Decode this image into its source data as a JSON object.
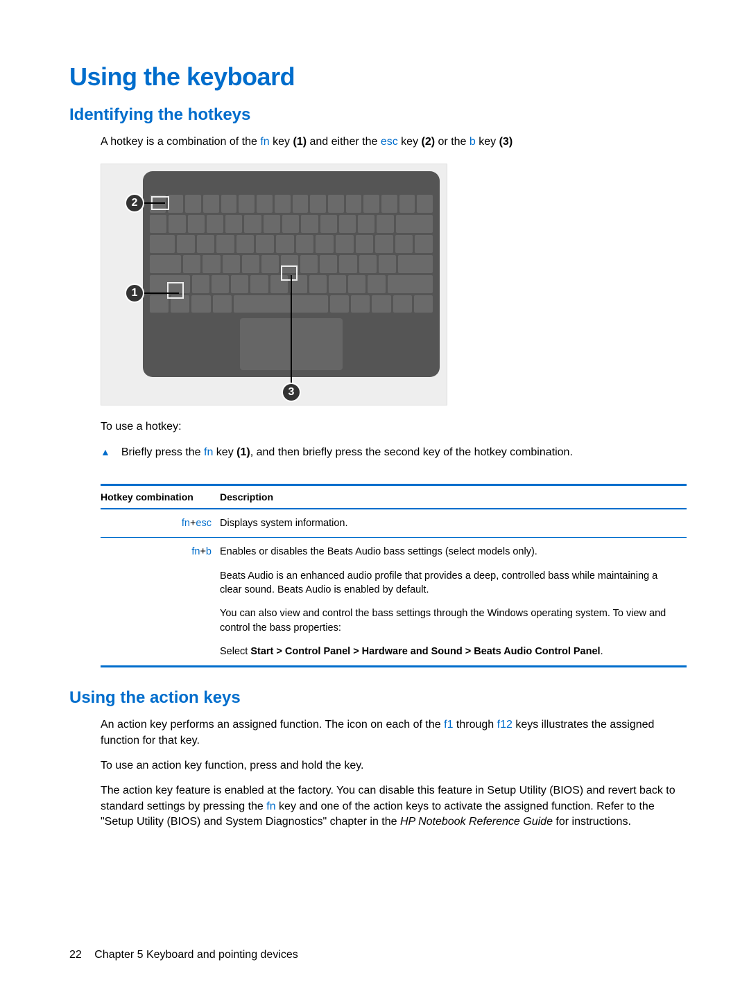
{
  "headings": {
    "main": "Using the keyboard",
    "sub1": "Identifying the hotkeys",
    "sub2": "Using the action keys"
  },
  "intro_parts": {
    "p1a": "A hotkey is a combination of the ",
    "fn": "fn",
    "p1b": " key ",
    "b1": "(1)",
    "p1c": " and either the ",
    "esc": "esc",
    "p1d": " key ",
    "b2": "(2)",
    "p1e": " or the ",
    "bkey": "b",
    "p1f": " key ",
    "b3": "(3)"
  },
  "callouts": {
    "one": "1",
    "two": "2",
    "three": "3"
  },
  "use_hotkey_label": "To use a hotkey:",
  "step_marker": "▲",
  "step_parts": {
    "a": "Briefly press the ",
    "fn": "fn",
    "b": " key ",
    "one": "(1)",
    "c": ", and then briefly press the second key of the hotkey combination."
  },
  "table": {
    "headers": {
      "combo": "Hotkey combination",
      "desc": "Description"
    },
    "row1": {
      "combo_a": "fn",
      "combo_plus": "+",
      "combo_b": "esc",
      "desc": "Displays system information."
    },
    "row2": {
      "combo_a": "fn",
      "combo_plus": "+",
      "combo_b": "b",
      "p1": "Enables or disables the Beats Audio bass settings (select models only).",
      "p2": "Beats Audio is an enhanced audio profile that provides a deep, controlled bass while maintaining a clear sound. Beats Audio is enabled by default.",
      "p3": "You can also view and control the bass settings through the Windows operating system. To view and control the bass properties:",
      "p4a": "Select ",
      "p4b": "Start > Control Panel > Hardware and Sound > Beats Audio Control Panel",
      "p4c": "."
    }
  },
  "action_keys": {
    "p1a": "An action key performs an assigned function. The icon on each of the ",
    "f1": "f1",
    "p1b": " through ",
    "f12": "f12",
    "p1c": " keys illustrates the assigned function for that key.",
    "p2": "To use an action key function, press and hold the key.",
    "p3a": "The action key feature is enabled at the factory. You can disable this feature in Setup Utility (BIOS) and revert back to standard settings by pressing the ",
    "fn": "fn",
    "p3b": " key and one of the action keys to activate the assigned function. Refer to the \"Setup Utility (BIOS) and System Diagnostics\" chapter in the ",
    "ref": "HP Notebook Reference Guide",
    "p3c": " for instructions."
  },
  "footer": {
    "page": "22",
    "chapter": "Chapter 5   Keyboard and pointing devices"
  }
}
